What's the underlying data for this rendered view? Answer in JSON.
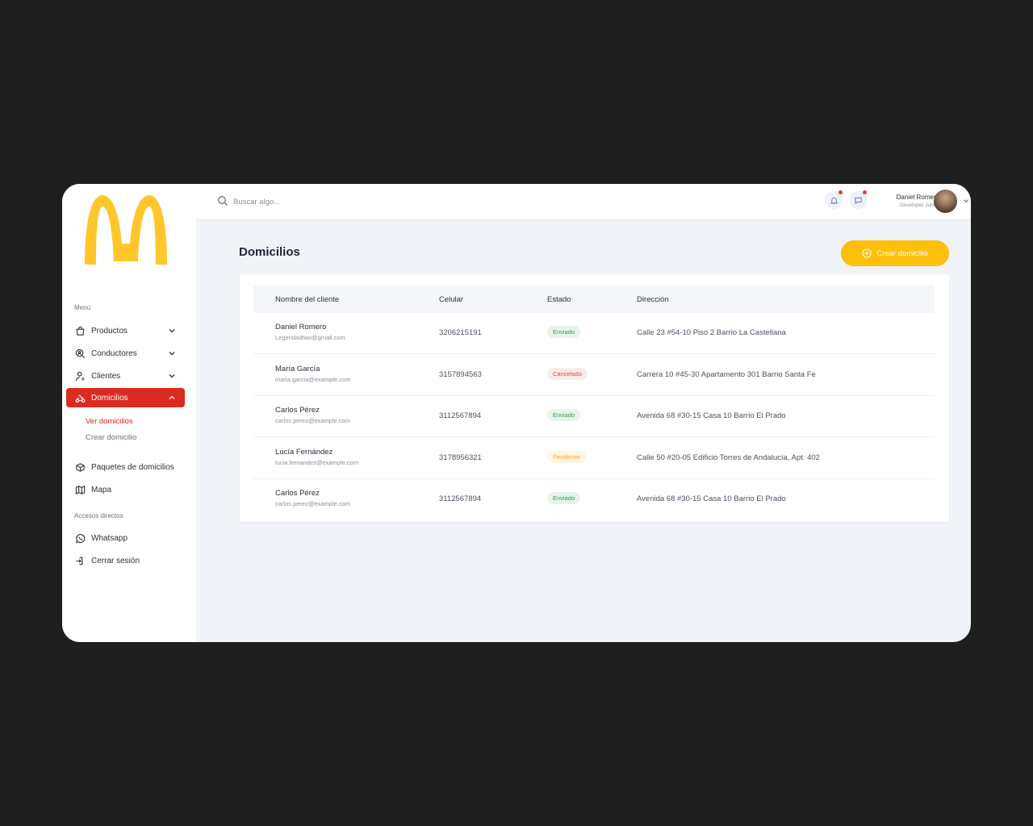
{
  "colors": {
    "brand_yellow": "#FFC72C",
    "active_red": "#DB2A1F",
    "enviado": "#2E9E4F",
    "cancelado": "#E0483D",
    "pendiente": "#F3A93B"
  },
  "sidebar": {
    "menu_heading": "Menú",
    "items": [
      {
        "label": "Productos",
        "icon": "shopping-bag-icon"
      },
      {
        "label": "Conductores",
        "icon": "driver-search-icon"
      },
      {
        "label": "Clientes",
        "icon": "user-icon"
      },
      {
        "label": "Domicilios",
        "icon": "scooter-icon"
      }
    ],
    "subitems": [
      {
        "label": "Ver domicilios"
      },
      {
        "label": "Crear domicilio"
      }
    ],
    "extra_items": [
      {
        "label": "Paquetes de domicilios",
        "icon": "package-icon"
      },
      {
        "label": "Mapa",
        "icon": "map-icon"
      }
    ],
    "shortcuts_heading": "Accesos directos",
    "shortcuts": [
      {
        "label": "Whatsapp",
        "icon": "whatsapp-icon"
      },
      {
        "label": "Cerrar sesión",
        "icon": "logout-icon"
      }
    ]
  },
  "header": {
    "search_placeholder": "Buscar algo...",
    "user_name": "Daniel Romero",
    "user_role": "Developer Junior"
  },
  "main": {
    "title": "Domicilios",
    "create_button": "Crear domicilio",
    "columns": [
      "Nombre del cliente",
      "Celular",
      "Estado",
      "Dirección"
    ],
    "rows": [
      {
        "name": "Daniel Romero",
        "email": "Legendadtwo@gmail.com",
        "phone": "3206215191",
        "status": "Enviado",
        "status_key": "enviado",
        "address": "Calle 23 #54-10 Piso 2 Barrio La Castellana"
      },
      {
        "name": "María García",
        "email": "maria.garcia@example.com",
        "phone": "3157894563",
        "status": "Cancelado",
        "status_key": "cancelado",
        "address": "Carrera 10 #45-30 Apartamento 301 Barrio Santa Fe"
      },
      {
        "name": "Carlos Pérez",
        "email": "carlos.perez@example.com",
        "phone": "3112567894",
        "status": "Enviado",
        "status_key": "enviado",
        "address": "Avenida 68 #30-15 Casa 10 Barrio El Prado"
      },
      {
        "name": "Lucía Fernández",
        "email": "lucia.fernandez@example.com",
        "phone": "3178956321",
        "status": "Pendiente",
        "status_key": "pendiente",
        "address": "Calle 50 #20-05 Edificio Torres de Andalucía, Apt. 402"
      },
      {
        "name": "Carlos Pérez",
        "email": "carlos.perez@example.com",
        "phone": "3112567894",
        "status": "Enviado",
        "status_key": "enviado",
        "address": "Avenida 68 #30-15 Casa 10 Barrio El Prado"
      }
    ]
  }
}
